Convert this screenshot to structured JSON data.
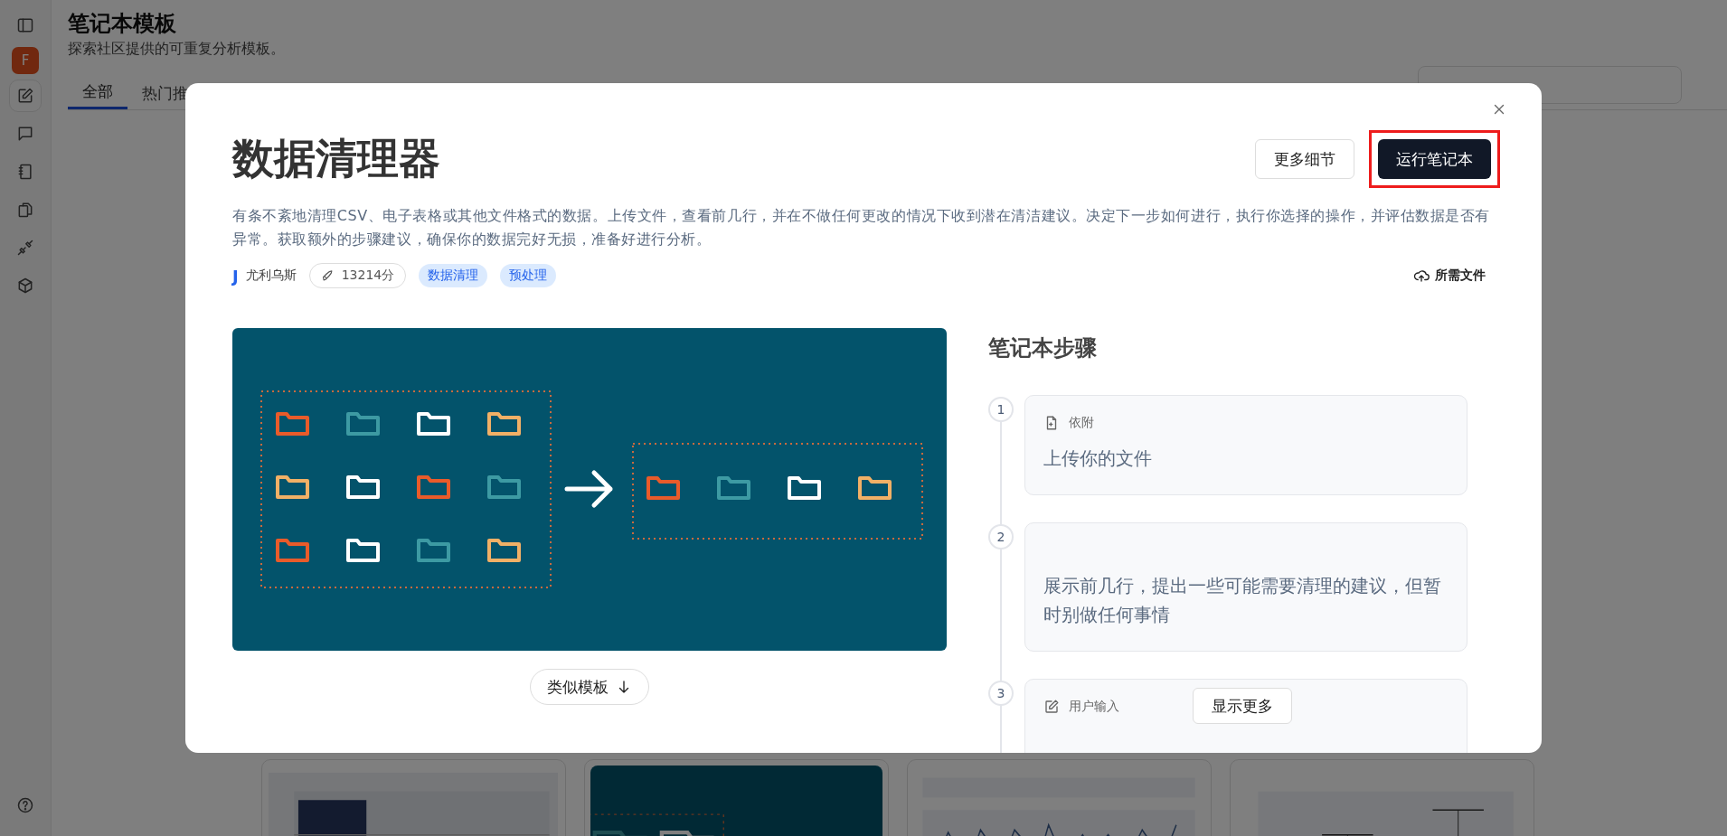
{
  "sidebar": {
    "avatar": "F",
    "items": [
      {
        "kind": "edit",
        "selected": true
      },
      {
        "kind": "chat",
        "selected": false
      },
      {
        "kind": "notebook",
        "selected": false
      },
      {
        "kind": "files",
        "selected": false
      },
      {
        "kind": "plug",
        "selected": false
      },
      {
        "kind": "cube",
        "selected": false
      }
    ]
  },
  "header": {
    "title": "笔记本模板",
    "subtitle": "探索社区提供的可重复分析模板。"
  },
  "tabs": [
    {
      "label": "全部",
      "selected": true
    },
    {
      "label": "热门推",
      "selected": false
    }
  ],
  "templates": [
    {
      "kind": "picture"
    },
    {
      "kind": "picture"
    },
    {
      "kind": "picture"
    },
    {
      "kind": "picture"
    }
  ],
  "modal": {
    "title": "数据清理器",
    "buttons": [
      {
        "label": "更多细节",
        "kind": "secondary",
        "highlighted": false
      },
      {
        "label": "运行笔记本",
        "kind": "primary",
        "highlighted": true
      }
    ],
    "description": "有条不紊地清理CSV、电子表格或其他文件格式的数据。上传文件，查看前几行，并在不做任何更改的情况下收到潜在清洁建议。决定下一步如何进行，执行你选择的操作，并评估数据是否有异常。获取额外的步骤建议，确保你的数据完好无损，准备好进行分析。",
    "author": {
      "initial": "J",
      "name": "尤利乌斯"
    },
    "score": "13214分",
    "tags": [
      "数据清理",
      "预处理"
    ],
    "files_link": "所需文件",
    "image": {
      "kind": "picture"
    },
    "similar_button": "类似模板",
    "steps_title": "笔记本步骤",
    "steps": [
      {
        "number": "1",
        "kind": "attachment",
        "label": "依附",
        "text": "上传你的文件"
      },
      {
        "number": "2",
        "kind": "plain",
        "text": "展示前几行，提出一些可能需要清理的建议，但暂时别做任何事情"
      },
      {
        "number": "3",
        "kind": "input",
        "label": "用户输入"
      }
    ],
    "show_more": "显示更多"
  }
}
